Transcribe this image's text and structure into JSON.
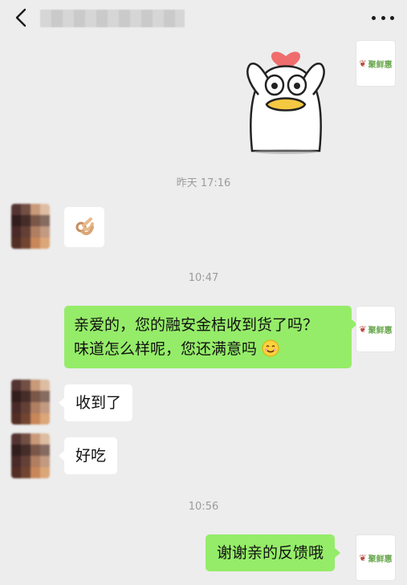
{
  "header": {
    "title": "",
    "back_icon": "chevron-left-icon",
    "more_icon": "ellipsis-icon"
  },
  "self_avatar_label": "聚鲜惠",
  "timestamps": {
    "t1": "昨天 17:16",
    "t2": "10:47",
    "t3": "10:56"
  },
  "messages": [
    {
      "sender": "self",
      "type": "sticker",
      "content": "duck-heart-sticker"
    },
    {
      "sender": "other",
      "type": "emoji",
      "content": "ok-hand-icon"
    },
    {
      "sender": "self",
      "type": "text",
      "lines": [
        "亲爱的，您的融安金桔收到货了吗？",
        "味道怎么样呢，您还满意吗"
      ],
      "trailing_icon": "smiling-face-icon"
    },
    {
      "sender": "other",
      "type": "text",
      "text": "收到了"
    },
    {
      "sender": "other",
      "type": "text",
      "text": "好吃"
    },
    {
      "sender": "self",
      "type": "text",
      "text": "谢谢亲的反馈哦"
    }
  ],
  "colors": {
    "background": "#ededed",
    "bubble_self": "#95ec69",
    "bubble_other": "#ffffff",
    "timestamp": "#9b9b9b",
    "brand_green": "#6aa84f"
  }
}
